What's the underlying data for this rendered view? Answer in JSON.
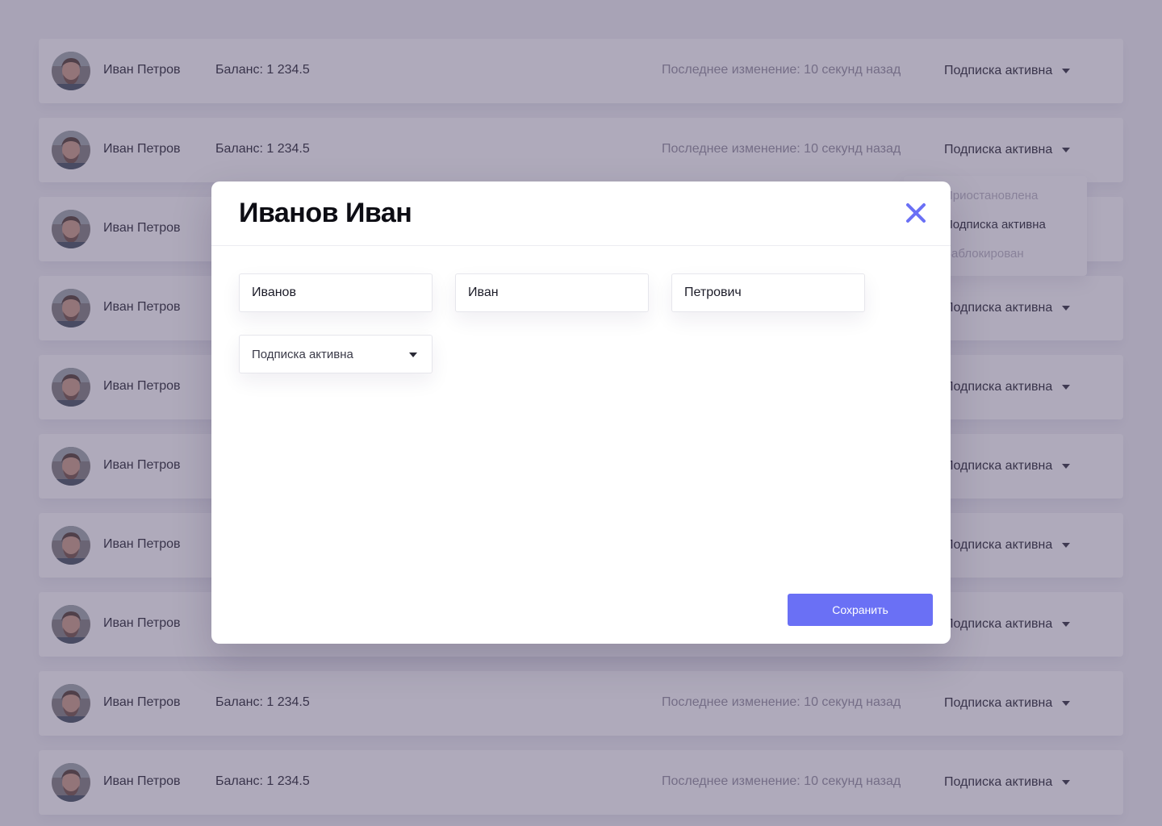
{
  "colors": {
    "accent": "#6a70f5",
    "overlay": "rgba(88, 78, 112, 0.48)",
    "muted_text": "#8e8a9a",
    "disabled_option": "#b6b3c0"
  },
  "user_rows": [
    {
      "name": "Иван Петров",
      "balance": "Баланс: 1 234.5",
      "last_change": "Последнее изменение: 10 секунд назад",
      "status": "Подписка активна"
    },
    {
      "name": "Иван Петров",
      "balance": "Баланс: 1 234.5",
      "last_change": "Последнее изменение: 10 секунд назад",
      "status": "Подписка активна"
    },
    {
      "name": "Иван Петров",
      "balance": "",
      "last_change": "",
      "status": ""
    },
    {
      "name": "Иван Петров",
      "balance": "",
      "last_change": "",
      "status": "Подписка активна"
    },
    {
      "name": "Иван Петров",
      "balance": "",
      "last_change": "",
      "status": "Подписка активна"
    },
    {
      "name": "Иван Петров",
      "balance": "",
      "last_change": "",
      "status": "Подписка активна"
    },
    {
      "name": "Иван Петров",
      "balance": "",
      "last_change": "",
      "status": "Подписка активна"
    },
    {
      "name": "Иван Петров",
      "balance": "",
      "last_change": "",
      "status": "Подписка активна"
    },
    {
      "name": "Иван Петров",
      "balance": "Баланс: 1 234.5",
      "last_change": "Последнее изменение: 10 секунд назад",
      "status": "Подписка активна"
    },
    {
      "name": "Иван Петров",
      "balance": "Баланс: 1 234.5",
      "last_change": "Последнее изменение: 10 секунд назад",
      "status": "Подписка активна"
    }
  ],
  "status_dropdown": {
    "options": [
      {
        "label": "Приостановлена",
        "enabled": false
      },
      {
        "label": "Подписка активна",
        "enabled": true
      },
      {
        "label": "Заблокирован",
        "enabled": false
      }
    ]
  },
  "modal": {
    "title": "Иванов Иван",
    "close_icon": "close-icon",
    "fields": {
      "last_name": "Иванов",
      "first_name": "Иван",
      "patronymic": "Петрович"
    },
    "status_select": {
      "value": "Подписка активна"
    },
    "save_label": "Сохранить"
  }
}
